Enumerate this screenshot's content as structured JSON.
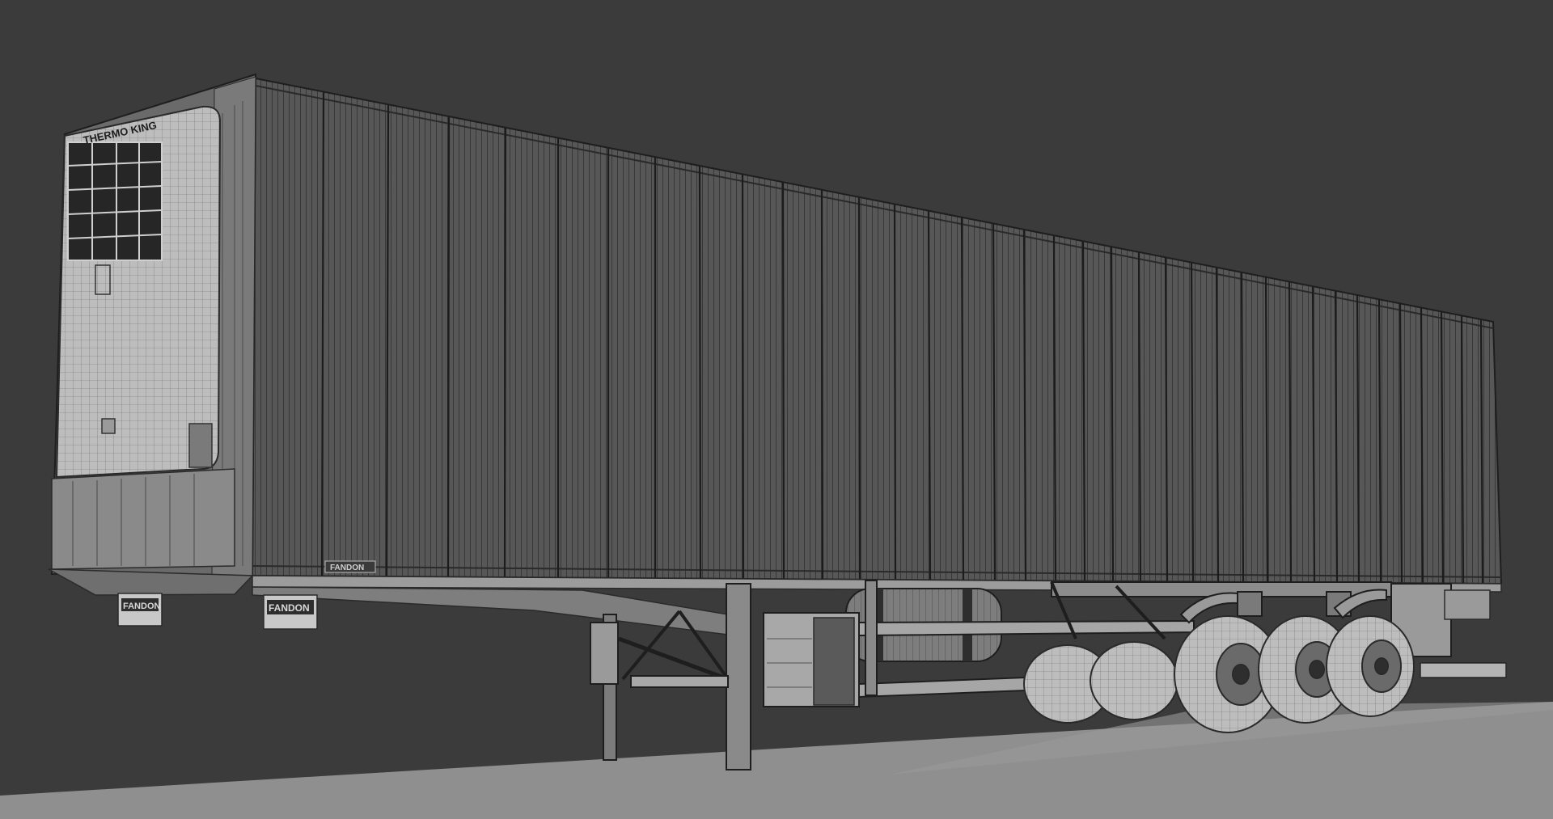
{
  "scene": {
    "background_color": "#3b3b3b",
    "floor_color": "#8f8f8f",
    "body_color": "#5a5a5a",
    "wire_color": "#2a2a2a",
    "unit_color": "#c8c8c8"
  },
  "labels": {
    "reefer_brand": "THERMO KING",
    "mudflap_left": "FANDON",
    "mudflap_right": "FANDON",
    "side_badge": "FANDON"
  }
}
